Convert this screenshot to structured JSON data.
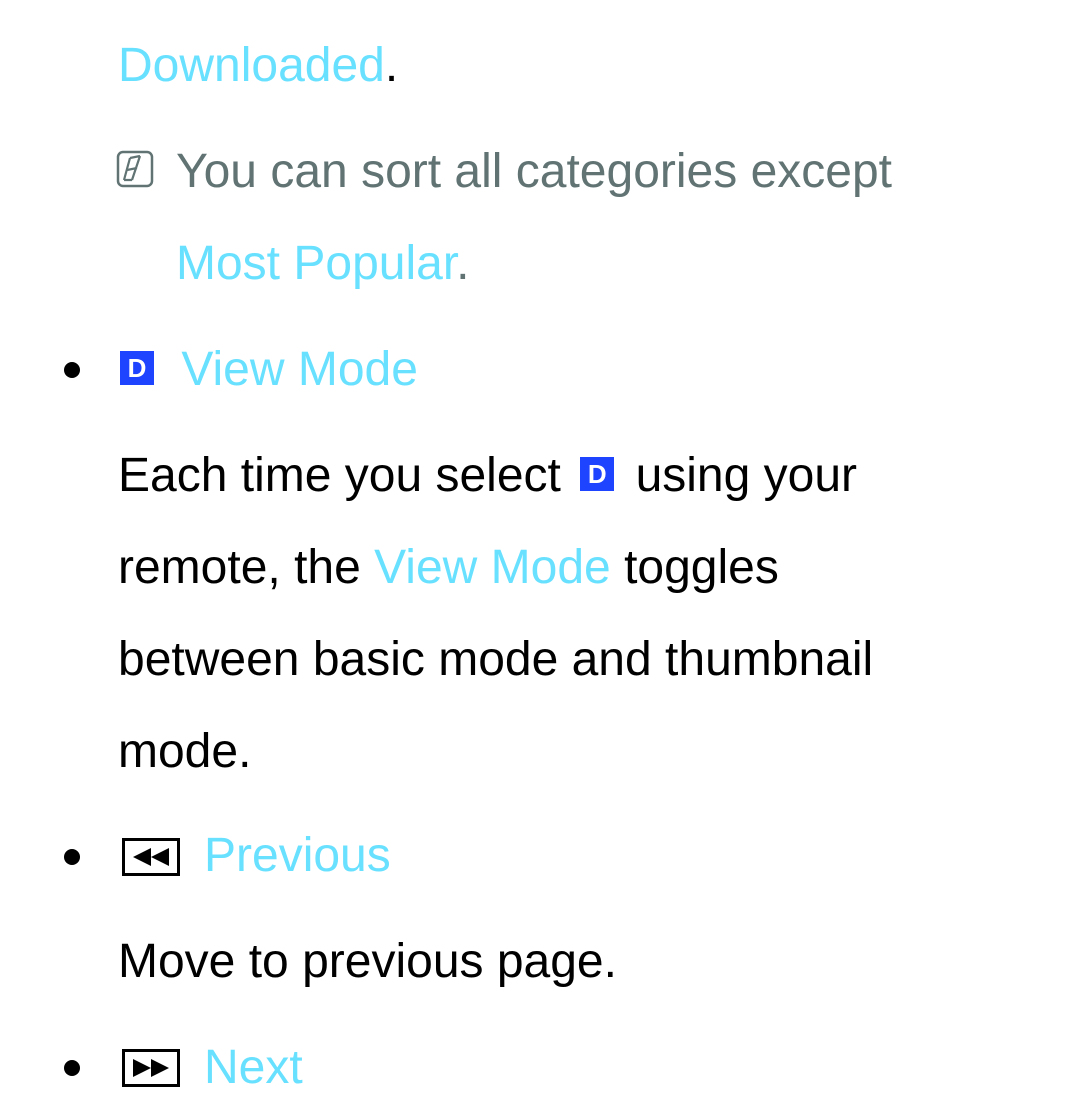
{
  "lines": {
    "downloaded": {
      "link": "Downloaded",
      "punct": "."
    },
    "note": {
      "icon": "note-pencil-icon",
      "text": "You can sort all categories except",
      "link": "Most Popular",
      "punct": "."
    },
    "view_mode": {
      "icon": "d-button-icon",
      "icon_label": "D",
      "title": "View Mode",
      "description": {
        "part1": "Each time you select",
        "icon_label": "D",
        "part2": "using your",
        "part3": "remote, the",
        "link": "View Mode",
        "part4": "toggles",
        "part5": "between basic mode and thumbnail",
        "part6": "mode."
      }
    },
    "previous": {
      "icon": "rewind-icon",
      "title": "Previous",
      "description": "Move to previous page."
    },
    "next": {
      "icon": "fast-forward-icon",
      "title": "Next"
    }
  },
  "colors": {
    "accent": "#68e0ff",
    "note_text": "#617373",
    "d_button": "#1f44ff",
    "body_text": "#000000"
  }
}
